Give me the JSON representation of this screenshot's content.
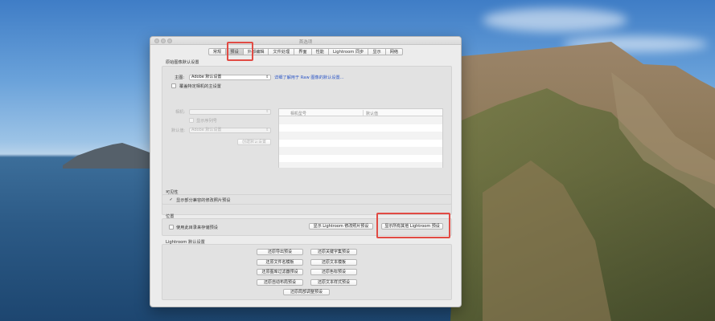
{
  "window": {
    "title": "首选项"
  },
  "tabs": [
    {
      "label": "常规",
      "active": false
    },
    {
      "label": "预设",
      "active": true
    },
    {
      "label": "外部编辑",
      "active": false
    },
    {
      "label": "文件处理",
      "active": false
    },
    {
      "label": "界面",
      "active": false
    },
    {
      "label": "性能",
      "active": false
    },
    {
      "label": "Lightroom 同步",
      "active": false
    },
    {
      "label": "显示",
      "active": false
    },
    {
      "label": "网络",
      "active": false
    }
  ],
  "raw_defaults": {
    "title": "原始图像默认设置",
    "master_label": "主图:",
    "master_value": "Adobe 默认设置",
    "learn_more_link": "详细了解用于 Raw 图像的默认设置...",
    "override_checkbox": "覆盖特定相机的主设置",
    "camera_label": "相机:",
    "show_serial_checkbox": "显示序列号",
    "default_label": "默认值:",
    "default_value": "Adobe 默认设置",
    "create_default_button": "创建默认设置",
    "table": {
      "columns": [
        "相机型号",
        "默认值"
      ],
      "rows": []
    }
  },
  "compatibility": {
    "title": "可见性",
    "checkbox_label": "显示部分兼容的修改照片预设",
    "checked": true
  },
  "location": {
    "title": "位置",
    "checkbox_label": "使用此目录来存储预设",
    "checked": false,
    "show_lr_develop_button": "显示 Lightroom 修改照片预设",
    "show_all_lr_button": "显示所有其他 Lightroom 预设"
  },
  "lr_defaults": {
    "title": "Lightroom 默认设置",
    "buttons": [
      "还原导出预设",
      "还原关键字集预设",
      "还原文件名模板",
      "还原文本模板",
      "还原图库过滤器预设",
      "还原色标预设",
      "还原自动布局预设",
      "还原文本样式预设",
      "还原局部调整预设"
    ]
  },
  "colors": {
    "highlight": "#e14b44",
    "link": "#2a55c6"
  }
}
